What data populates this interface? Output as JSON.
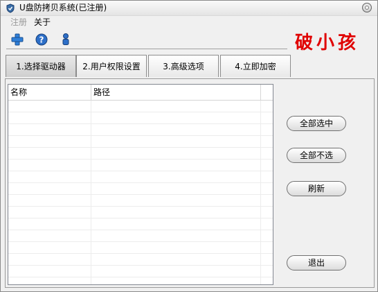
{
  "window": {
    "title": "U盘防拷贝系统(已注册)"
  },
  "menu": [
    {
      "label": "注册",
      "disabled": true
    },
    {
      "label": "关于",
      "disabled": false
    }
  ],
  "toolbar": {
    "icons": [
      "add-icon",
      "help-icon",
      "user-icon"
    ]
  },
  "brand": {
    "text": "破小孩",
    "color": "#e00000"
  },
  "tabs": [
    {
      "label": "1.选择驱动器",
      "active": true
    },
    {
      "label": "2.用户权限设置",
      "active": false
    },
    {
      "label": "3.高级选项",
      "active": false
    },
    {
      "label": "4.立即加密",
      "active": false
    }
  ],
  "list": {
    "columns": [
      {
        "label": "名称"
      },
      {
        "label": "路径"
      }
    ],
    "rows": []
  },
  "buttons": {
    "select_all": "全部选中",
    "select_none": "全部不选",
    "refresh": "刷新",
    "exit": "退出"
  }
}
